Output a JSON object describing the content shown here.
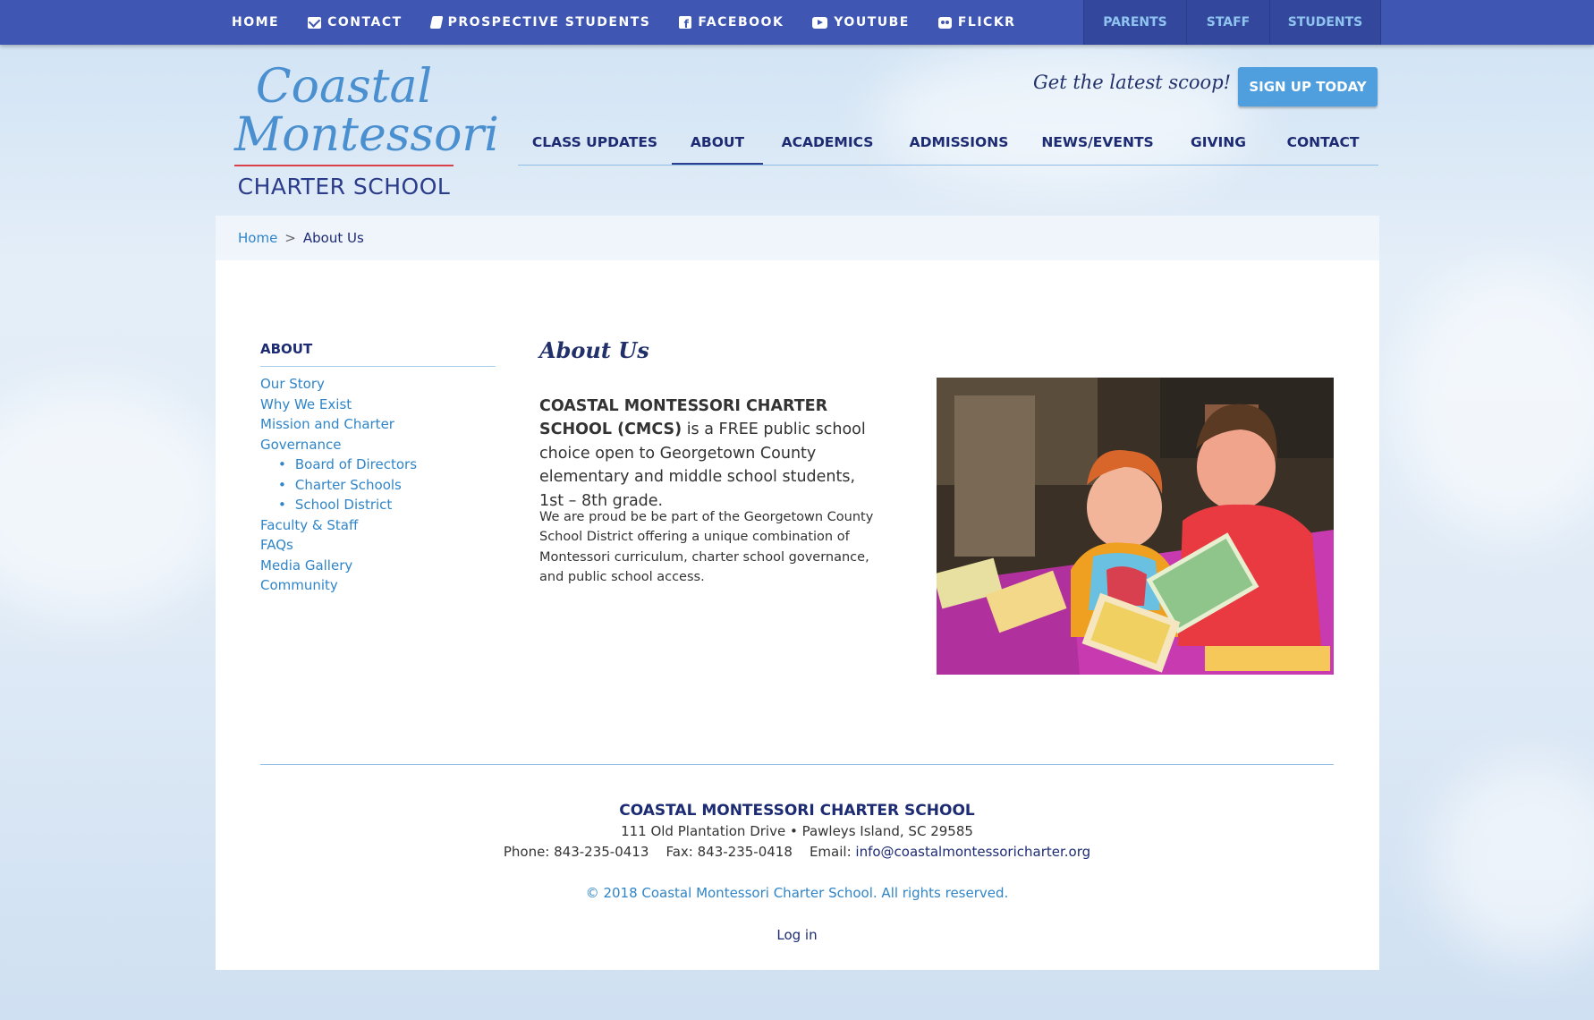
{
  "top_nav": {
    "home": "HOME",
    "contact": "CONTACT",
    "prospective": "PROSPECTIVE STUDENTS",
    "facebook": "FACEBOOK",
    "youtube": "YOUTUBE",
    "flickr": "FLICKR"
  },
  "audience_nav": {
    "parents": "PARENTS",
    "staff": "STAFF",
    "students": "STUDENTS"
  },
  "logo": {
    "line1": "Coastal",
    "line2": "Montessori",
    "line3": "CHARTER SCHOOL"
  },
  "promo": {
    "tagline": "Get the latest scoop!",
    "button": "SIGN UP TODAY"
  },
  "main_nav": {
    "class_updates": "CLASS UPDATES",
    "about": "ABOUT",
    "academics": "ACADEMICS",
    "admissions": "ADMISSIONS",
    "news_events": "NEWS/EVENTS",
    "giving": "GIVING",
    "contact": "CONTACT",
    "active": "ABOUT"
  },
  "breadcrumb": {
    "home": "Home",
    "separator": ">",
    "current": "About Us"
  },
  "sidebar": {
    "title": "ABOUT",
    "our_story": "Our Story",
    "why_we_exist": "Why We Exist",
    "mission": "Mission and Charter",
    "governance": "Governance",
    "board": "Board of Directors",
    "charter_schools": "Charter Schools",
    "school_district": "School District",
    "faculty": "Faculty & Staff",
    "faqs": "FAQs",
    "media": "Media Gallery",
    "community": "Community"
  },
  "content": {
    "heading": "About Us",
    "lead_bold": "COASTAL MONTESSORI CHARTER SCHOOL (CMCS)",
    "lead_rest": " is a FREE public school choice open to Georgetown County elementary and middle school students, 1st – 8th grade.",
    "body": "We are proud be be part of the Georgetown County School District offering a unique combination of Montessori curriculum, charter school governance, and public school access."
  },
  "footer": {
    "school": "COASTAL MONTESSORI CHARTER SCHOOL",
    "address": "111 Old Plantation Drive • Pawleys Island, SC 29585",
    "phone": "Phone: 843-235-0413",
    "fax": "Fax: 843-235-0418",
    "email_label": "Email:",
    "email": "info@coastalmontessoricharter.org",
    "copyright": "© 2018 Coastal Montessori Charter School. All rights reserved.",
    "login": "Log in"
  },
  "colors": {
    "topbar": "#3f57b2",
    "navy": "#1d2b73",
    "link": "#2f85c8",
    "button": "#4f9ede",
    "logo_blue": "#4a8fcf",
    "logo_red": "#d9404a"
  }
}
